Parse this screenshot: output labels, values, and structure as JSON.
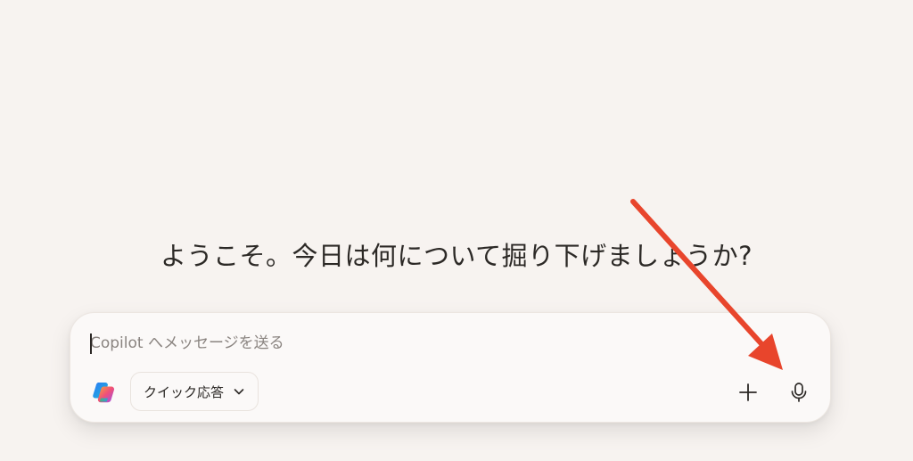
{
  "greeting": {
    "text": "ようこそ。今日は何について掘り下げましょうか?"
  },
  "composer": {
    "placeholder": "Copilot へメッセージを送る",
    "value": "",
    "mode_button": {
      "label": "クイック応答"
    }
  },
  "icons": {
    "logo": "copilot-logo-icon",
    "mode_chevron": "chevron-down-icon",
    "add": "plus-icon",
    "mic": "microphone-icon",
    "annotation": "red-arrow-annotation"
  },
  "colors": {
    "background": "#f7f3f0",
    "composer": "#fbf9f8",
    "text": "#2c2926",
    "placeholder": "#8a8480",
    "annotation_arrow": "#e8452c"
  }
}
